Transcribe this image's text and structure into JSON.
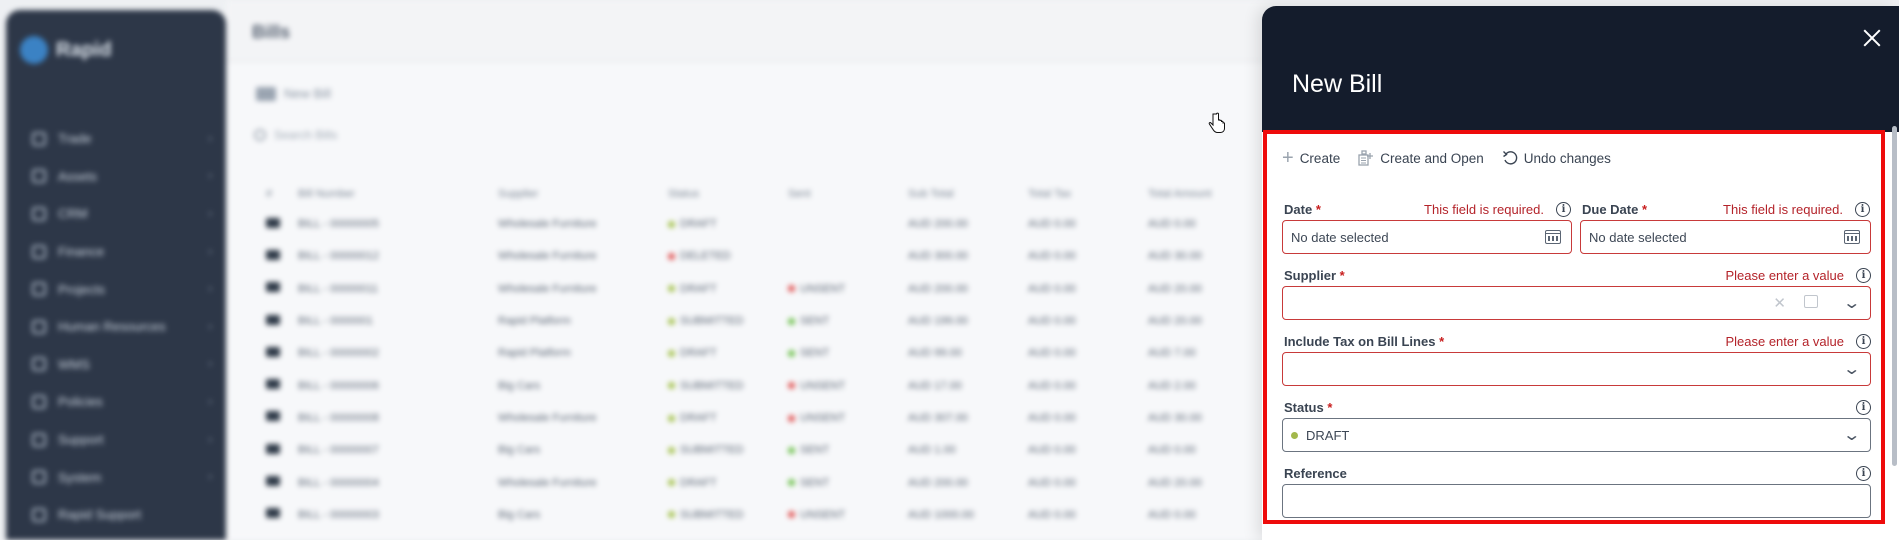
{
  "background": {
    "app_name": "Rapid",
    "page_title": "Bills",
    "new_button": "New Bill",
    "search_placeholder": "Search Bills",
    "nav": [
      "Trade",
      "Assets",
      "CRM",
      "Finance",
      "Projects",
      "Human Resources",
      "WMS",
      "Policies",
      "Support",
      "System",
      "Rapid Support"
    ],
    "columns": [
      "Bill Number",
      "Supplier",
      "Status",
      "Sent",
      "Sub Total",
      "Total Tax",
      "Total Amount"
    ],
    "rows": [
      {
        "number": "BILL - 00000005",
        "supplier": "Wholesale Furniture",
        "status": "DRAFT",
        "status_color": "#a3c14a",
        "sent": "",
        "sent_color": "",
        "subtotal": "AUD 200.00",
        "tax": "AUD 0.00",
        "total": "AUD 0.00"
      },
      {
        "number": "BILL - 00000012",
        "supplier": "Wholesale Furniture",
        "status": "DELETED",
        "status_color": "#e05252",
        "sent": "",
        "sent_color": "",
        "subtotal": "AUD 300.00",
        "tax": "AUD 0.00",
        "total": "AUD 30.00"
      },
      {
        "number": "BILL - 00000011",
        "supplier": "Wholesale Furniture",
        "status": "DRAFT",
        "status_color": "#a3c14a",
        "sent": "UNSENT",
        "sent_color": "#e05252",
        "subtotal": "AUD 200.00",
        "tax": "AUD 0.00",
        "total": "AUD 20.00"
      },
      {
        "number": "BILL - 0000001",
        "supplier": "Rapid Platform",
        "status": "SUBMITTED",
        "status_color": "#a3c14a",
        "sent": "SENT",
        "sent_color": "#6cc04a",
        "subtotal": "AUD 199.00",
        "tax": "AUD 0.00",
        "total": "AUD 20.00"
      },
      {
        "number": "BILL - 00000002",
        "supplier": "Rapid Platform",
        "status": "DRAFT",
        "status_color": "#a3c14a",
        "sent": "SENT",
        "sent_color": "#6cc04a",
        "subtotal": "AUD 99.00",
        "tax": "AUD 0.00",
        "total": "AUD 7.00"
      },
      {
        "number": "BILL - 00000006",
        "supplier": "Big Cars",
        "status": "SUBMITTED",
        "status_color": "#a3c14a",
        "sent": "UNSENT",
        "sent_color": "#e05252",
        "subtotal": "AUD 17.00",
        "tax": "AUD 0.00",
        "total": "AUD 2.00"
      },
      {
        "number": "BILL - 00000008",
        "supplier": "Wholesale Furniture",
        "status": "DRAFT",
        "status_color": "#a3c14a",
        "sent": "UNSENT",
        "sent_color": "#e05252",
        "subtotal": "AUD 307.00",
        "tax": "AUD 0.00",
        "total": "AUD 30.00"
      },
      {
        "number": "BILL - 00000007",
        "supplier": "Big Cars",
        "status": "SUBMITTED",
        "status_color": "#a3c14a",
        "sent": "SENT",
        "sent_color": "#6cc04a",
        "subtotal": "AUD 1.00",
        "tax": "AUD 0.00",
        "total": "AUD 0.00"
      },
      {
        "number": "BILL - 00000004",
        "supplier": "Wholesale Furniture",
        "status": "DRAFT",
        "status_color": "#a3c14a",
        "sent": "SENT",
        "sent_color": "#6cc04a",
        "subtotal": "AUD 200.00",
        "tax": "AUD 0.00",
        "total": "AUD 20.00"
      },
      {
        "number": "BILL - 00000003",
        "supplier": "Big Cars",
        "status": "SUBMITTED",
        "status_color": "#a3c14a",
        "sent": "UNSENT",
        "sent_color": "#e05252",
        "subtotal": "AUD 1000.00",
        "tax": "AUD 0.00",
        "total": "AUD 0.00"
      }
    ]
  },
  "drawer": {
    "title": "New Bill",
    "actions": {
      "create": "Create",
      "create_open": "Create and Open",
      "undo": "Undo changes"
    },
    "fields": {
      "date": {
        "label": "Date",
        "required": "*",
        "error": "This field is required.",
        "placeholder": "No date selected"
      },
      "due_date": {
        "label": "Due Date",
        "required": "*",
        "error": "This field is required.",
        "placeholder": "No date selected"
      },
      "supplier": {
        "label": "Supplier",
        "required": "*",
        "error": "Please enter a value",
        "value": ""
      },
      "include_tax": {
        "label": "Include Tax on Bill Lines",
        "required": "*",
        "error": "Please enter a value",
        "value": ""
      },
      "status": {
        "label": "Status",
        "required": "*",
        "value": "DRAFT",
        "dot_color": "#a3b84c"
      },
      "reference": {
        "label": "Reference",
        "value": ""
      }
    },
    "info_glyph": "i"
  },
  "colors": {
    "drawer_header": "#141c2c",
    "error": "#b4232a",
    "highlight": "#ee0b0b"
  }
}
